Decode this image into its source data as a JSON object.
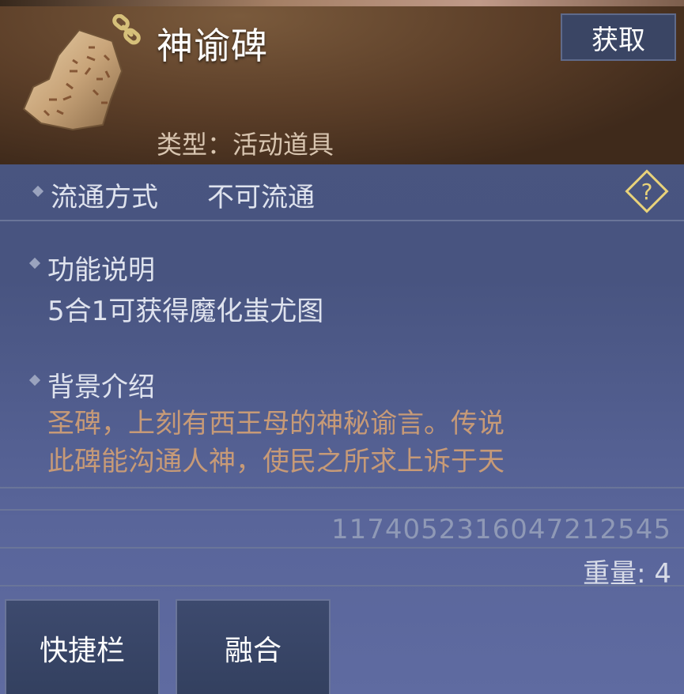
{
  "item": {
    "name": "神谕碑",
    "type_label": "类型：活动道具",
    "get_button": "获取"
  },
  "circulation": {
    "label": "流通方式",
    "value": "不可流通"
  },
  "function": {
    "label": "功能说明",
    "text": "5合1可获得魔化蚩尤图"
  },
  "background": {
    "label": "背景介绍",
    "line1": "圣碑，上刻有西王母的神秘谕言。传说",
    "line2": "此碑能沟通人神，使民之所求上诉于天"
  },
  "meta": {
    "id": "1174052316047212545",
    "weight": "重量: 4"
  },
  "actions": {
    "quickbar": "快捷栏",
    "merge": "融合"
  },
  "colors": {
    "panel_bg": "#4a5680",
    "header_bg": "#5b3e28",
    "description": "#c79a77",
    "help_icon": "#e8d27a"
  }
}
